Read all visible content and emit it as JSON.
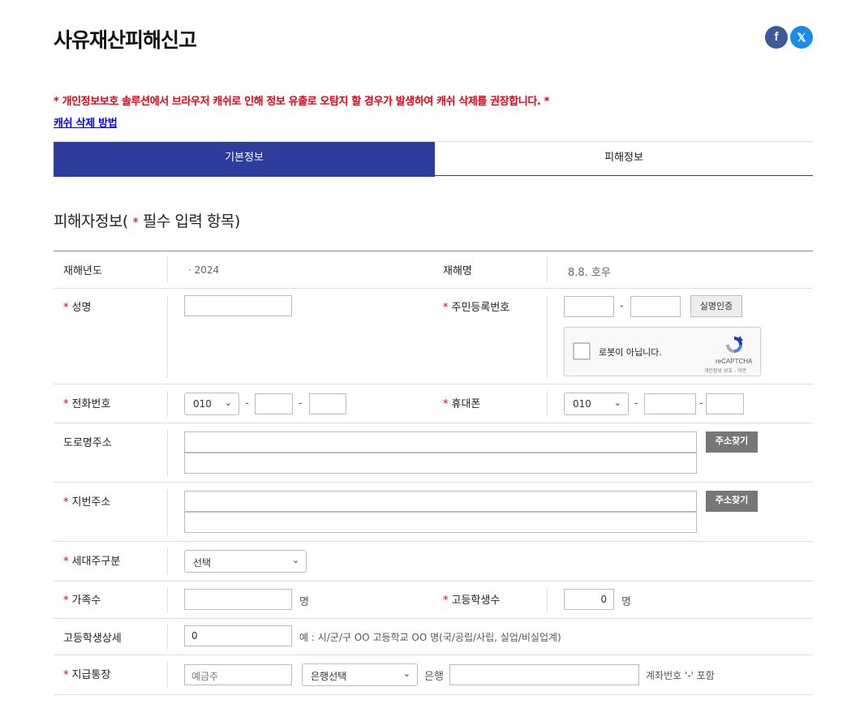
{
  "header": {
    "title": "사유재산피해신고",
    "share_facebook": "f",
    "share_x": "𝕏"
  },
  "notice": "* 개인정보보호 솔루션에서 브라우저 캐쉬로 인해 정보 유출로 오탐지 할 경우가 발생하여 캐쉬 삭제를 권장합니다. *",
  "cache_link": "캐쉬 삭제 방법",
  "tabs": [
    {
      "label": "기본정보",
      "active": true
    },
    {
      "label": "피해정보",
      "active": false
    }
  ],
  "section": {
    "title_prefix": "피해자정보(",
    "required_star": "*",
    "title_suffix": "필수 입력 항목)"
  },
  "required_mark": "*",
  "fields": {
    "year_label": "재해년도",
    "year_value": "· 2024",
    "disaster_label": "재해명",
    "disaster_value": "8.8. 호우",
    "name_label": "성명",
    "name_value": "",
    "rrn_label": "주민등록번호",
    "rrn_dash": "-",
    "verify_button": "실명인증",
    "captcha_text": "로봇이 아닙니다.",
    "captcha_brand": "reCAPTCHA",
    "captcha_terms": "개인정보 보호 - 약관",
    "phone_label": "전화번호",
    "phone_prefix": "010",
    "phone_dash": "-",
    "mobile_label": "휴대폰",
    "mobile_prefix": "010",
    "road_address_label": "도로명주소",
    "find_address_button": "주소찾기",
    "lot_address_label": "지번주소",
    "household_label": "세대주구분",
    "household_select": "선택",
    "family_label": "가족수",
    "family_unit": "명",
    "hs_students_label": "고등학생수",
    "hs_students_value": "0",
    "hs_unit": "명",
    "hs_detail_label": "고등학생상세",
    "hs_detail_value": "0",
    "hs_detail_hint": "예 : 시/군/구 OO 고등학교 OO 명(국/공립/사립, 실업/비실업계)",
    "account_label": "지급통장",
    "account_holder_placeholder": "예금주",
    "bank_select": "은행선택",
    "bank_label": "은행",
    "account_hint": "계좌번호 '-' 포함"
  },
  "colors": {
    "tab_active": "#2e3d9b",
    "required": "#e60012",
    "facebook": "#3b5a9a",
    "x": "#1d8ae6"
  }
}
